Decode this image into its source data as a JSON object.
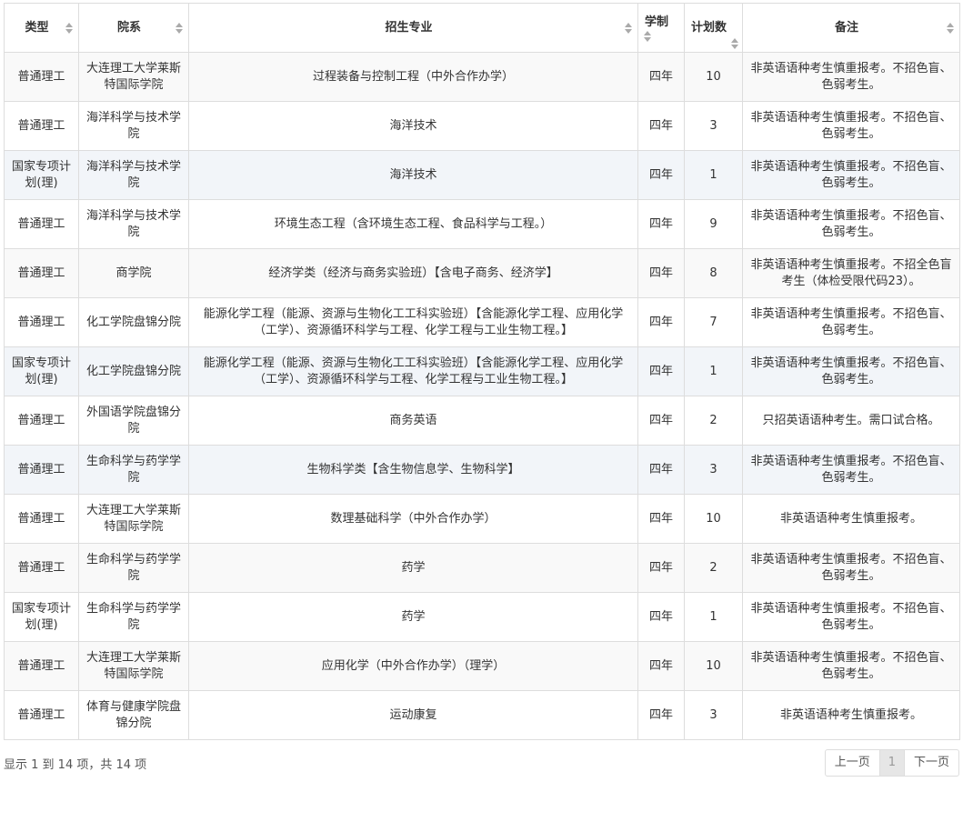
{
  "columns": {
    "type": "类型",
    "dept": "院系",
    "major": "招生专业",
    "years": "学制",
    "plan": "计划数",
    "note": "备注"
  },
  "rows": [
    {
      "type": "普通理工",
      "dept": "大连理工大学莱斯特国际学院",
      "major": "过程装备与控制工程（中外合作办学）",
      "years": "四年",
      "plan": "10",
      "note": "非英语语种考生慎重报考。不招色盲、色弱考生。"
    },
    {
      "type": "普通理工",
      "dept": "海洋科学与技术学院",
      "major": "海洋技术",
      "years": "四年",
      "plan": "3",
      "note": "非英语语种考生慎重报考。不招色盲、色弱考生。"
    },
    {
      "type": "国家专项计划(理)",
      "dept": "海洋科学与技术学院",
      "major": "海洋技术",
      "years": "四年",
      "plan": "1",
      "note": "非英语语种考生慎重报考。不招色盲、色弱考生。"
    },
    {
      "type": "普通理工",
      "dept": "海洋科学与技术学院",
      "major": "环境生态工程（含环境生态工程、食品科学与工程。）",
      "years": "四年",
      "plan": "9",
      "note": "非英语语种考生慎重报考。不招色盲、色弱考生。"
    },
    {
      "type": "普通理工",
      "dept": "商学院",
      "major": "经济学类（经济与商务实验班）【含电子商务、经济学】",
      "years": "四年",
      "plan": "8",
      "note": "非英语语种考生慎重报考。不招全色盲考生（体检受限代码23）。"
    },
    {
      "type": "普通理工",
      "dept": "化工学院盘锦分院",
      "major": "能源化学工程（能源、资源与生物化工工科实验班）【含能源化学工程、应用化学（工学）、资源循环科学与工程、化学工程与工业生物工程。】",
      "years": "四年",
      "plan": "7",
      "note": "非英语语种考生慎重报考。不招色盲、色弱考生。"
    },
    {
      "type": "国家专项计划(理)",
      "dept": "化工学院盘锦分院",
      "major": "能源化学工程（能源、资源与生物化工工科实验班）【含能源化学工程、应用化学（工学）、资源循环科学与工程、化学工程与工业生物工程。】",
      "years": "四年",
      "plan": "1",
      "note": "非英语语种考生慎重报考。不招色盲、色弱考生。"
    },
    {
      "type": "普通理工",
      "dept": "外国语学院盘锦分院",
      "major": "商务英语",
      "years": "四年",
      "plan": "2",
      "note": "只招英语语种考生。需口试合格。"
    },
    {
      "type": "普通理工",
      "dept": "生命科学与药学学院",
      "major": "生物科学类【含生物信息学、生物科学】",
      "years": "四年",
      "plan": "3",
      "note": "非英语语种考生慎重报考。不招色盲、色弱考生。"
    },
    {
      "type": "普通理工",
      "dept": "大连理工大学莱斯特国际学院",
      "major": "数理基础科学（中外合作办学）",
      "years": "四年",
      "plan": "10",
      "note": "非英语语种考生慎重报考。"
    },
    {
      "type": "普通理工",
      "dept": "生命科学与药学学院",
      "major": "药学",
      "years": "四年",
      "plan": "2",
      "note": "非英语语种考生慎重报考。不招色盲、色弱考生。"
    },
    {
      "type": "国家专项计划(理)",
      "dept": "生命科学与药学学院",
      "major": "药学",
      "years": "四年",
      "plan": "1",
      "note": "非英语语种考生慎重报考。不招色盲、色弱考生。"
    },
    {
      "type": "普通理工",
      "dept": "大连理工大学莱斯特国际学院",
      "major": "应用化学（中外合作办学）（理学）",
      "years": "四年",
      "plan": "10",
      "note": "非英语语种考生慎重报考。不招色盲、色弱考生。"
    },
    {
      "type": "普通理工",
      "dept": "体育与健康学院盘锦分院",
      "major": "运动康复",
      "years": "四年",
      "plan": "3",
      "note": "非英语语种考生慎重报考。"
    }
  ],
  "footer": {
    "info": "显示 1 到 14 项，共 14 项",
    "prev": "上一页",
    "page": "1",
    "next": "下一页"
  },
  "colors": {
    "border": "#dddddd",
    "stripe": "#f9f9f9",
    "highlight": "#f2f5f9"
  }
}
